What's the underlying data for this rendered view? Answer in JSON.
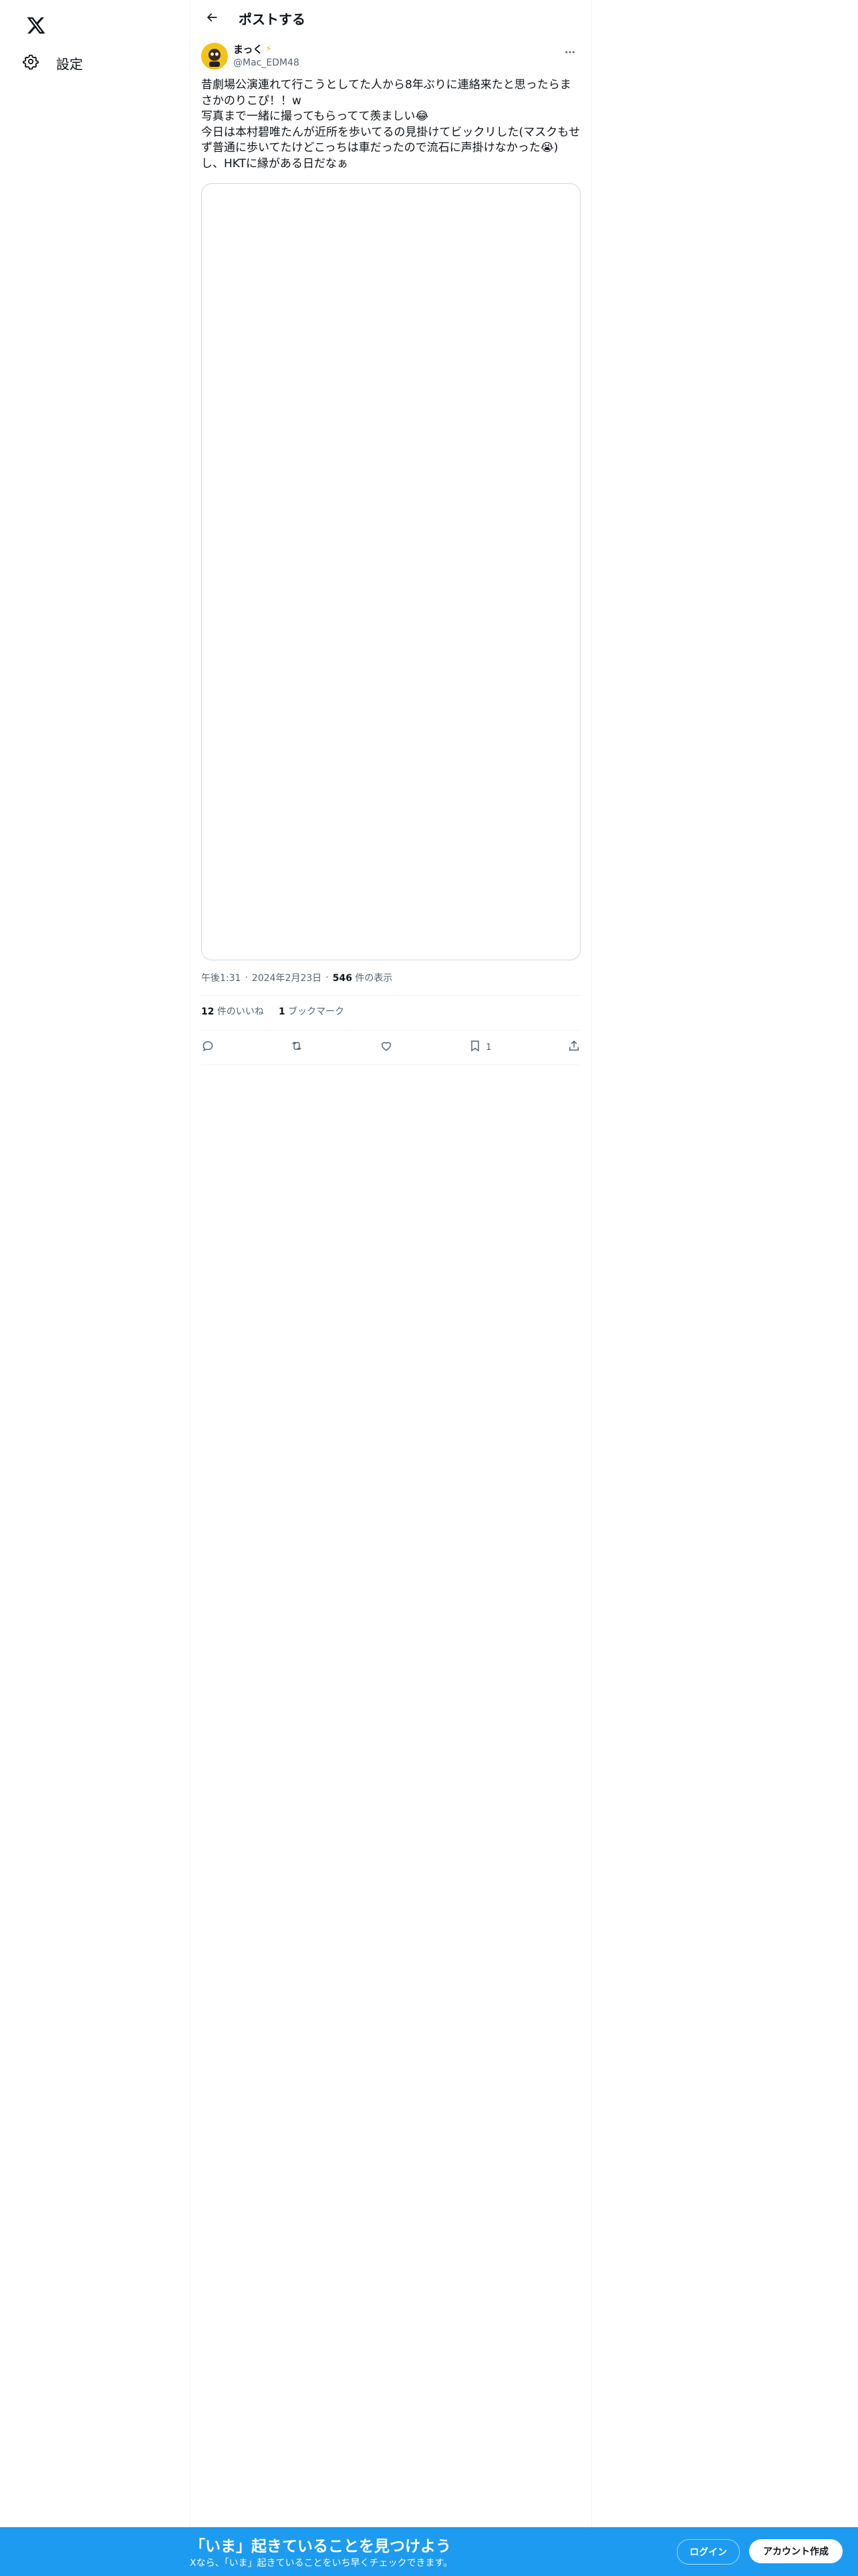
{
  "nav": {
    "logo_icon": "x-logo-icon",
    "settings_label": "設定",
    "settings_icon": "gear-icon"
  },
  "header": {
    "title": "ポストする",
    "back_icon": "arrow-left-icon"
  },
  "tweet": {
    "display_name": "まっく",
    "handle": "@Mac_EDM48",
    "text": "昔劇場公演連れて行こうとしてた人から8年ぶりに連絡来たと思ったらまさかのりこぴ！！w\n写真まで一緒に撮ってもらってて羨ましい😂\n今日は本村碧唯たんが近所を歩いてるの見掛けてビックリした(マスクもせず普通に歩いてたけどこっちは車だったので流石に声掛けなかった😭)し、HKTに縁がある日だなぁ",
    "time": "午後1:31",
    "date": "2024年2月23日",
    "views_count": "546",
    "views_label": "件の表示",
    "likes_count": "12",
    "likes_label": "件のいいね",
    "bookmarks_count": "1",
    "bookmarks_label": "ブックマーク",
    "action_bookmark_count": "1"
  },
  "banner": {
    "title": "「いま」起きていることを見つけよう",
    "subtitle": "Xなら、「いま」起きていることをいち早くチェックできます。",
    "login_label": "ログイン",
    "signup_label": "アカウント作成"
  },
  "colors": {
    "accent": "#1d9bf0",
    "text": "#0f1419",
    "secondary": "#536471",
    "avatar": "#f2c318"
  }
}
